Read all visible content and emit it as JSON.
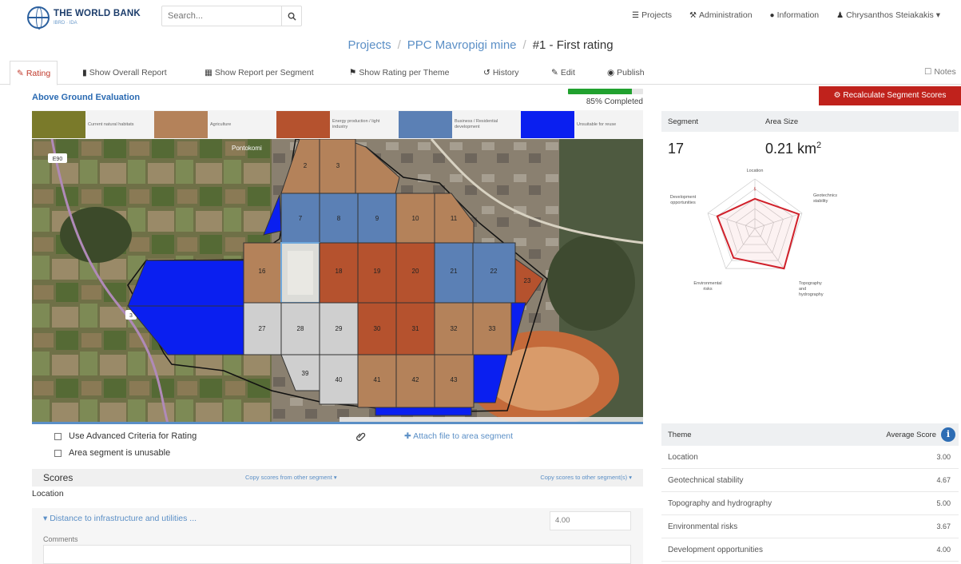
{
  "brand": {
    "name": "THE WORLD BANK",
    "sub": "IBRD · IDA"
  },
  "search": {
    "placeholder": "Search..."
  },
  "nav": {
    "projects": "Projects",
    "administration": "Administration",
    "information": "Information",
    "user": "Chrysanthos Steiakakis ▾"
  },
  "breadcrumb": {
    "projects": "Projects",
    "mine": "PPC Mavropigi mine",
    "current": "#1 - First rating"
  },
  "tabs": {
    "rating": "Rating",
    "overall_report": "Show Overall Report",
    "report_per_segment": "Show Report per Segment",
    "rating_per_theme": "Show Rating per Theme",
    "history": "History",
    "edit": "Edit",
    "publish": "Publish",
    "notes": "Notes"
  },
  "evaluation": {
    "title": "Above Ground Evaluation",
    "progress_percent": 85,
    "progress_label": "85% Completed"
  },
  "legend": [
    {
      "label": "Current natural habitats",
      "color": "#7a7a2a"
    },
    {
      "label": "Agriculture",
      "color": "#b4825a"
    },
    {
      "label": "Energy production / light industry",
      "color": "#b5522e"
    },
    {
      "label": "Business / Residential development",
      "color": "#5b80b5"
    },
    {
      "label": "Unsuitable for reuse",
      "color": "#0a1ff0"
    }
  ],
  "map": {
    "labels": {
      "s2": "2",
      "s3": "3",
      "s7": "7",
      "s8": "8",
      "s9": "9",
      "s10": "10",
      "s11": "11",
      "s16": "16",
      "s18": "18",
      "s19": "19",
      "s20": "20",
      "s21": "21",
      "s22": "22",
      "s23": "23",
      "s27": "27",
      "s28": "28",
      "s29": "29",
      "s30": "30",
      "s31": "31",
      "s32": "32",
      "s33": "33",
      "s39": "39",
      "s40": "40",
      "s41": "41",
      "s42": "42",
      "s43": "43",
      "road": "E90",
      "village": "Pontokomi",
      "road2": "3"
    }
  },
  "options": {
    "advanced_criteria": "Use Advanced Criteria for Rating",
    "unusable": "Area segment is unusable",
    "attach": "Attach file to area segment"
  },
  "scores": {
    "title": "Scores",
    "copy_from": "Copy scores from other segment ▾",
    "copy_to": "Copy scores to other segment(s) ▾",
    "location_label": "Location",
    "criterion": "Distance to infrastructure and utilities ...",
    "criterion_value": "4.00",
    "comments_label": "Comments"
  },
  "segment": {
    "header_segment": "Segment",
    "header_area": "Area Size",
    "number": "17",
    "area": "0.21 km",
    "area_unit_sup": "2",
    "recalc_label": "Recalculate Segment Scores"
  },
  "radar": {
    "axes": [
      "Location",
      "Geotechnical stability",
      "Topography and hydrography",
      "Environmental risks",
      "Development opportunities"
    ],
    "values": [
      3.0,
      4.67,
      5.0,
      3.67,
      4.0
    ],
    "max": 5
  },
  "themes": {
    "header_theme": "Theme",
    "header_score": "Average Score",
    "rows": [
      {
        "name": "Location",
        "score": "3.00"
      },
      {
        "name": "Geotechnical stability",
        "score": "4.67"
      },
      {
        "name": "Topography and hydrography",
        "score": "5.00"
      },
      {
        "name": "Environmental risks",
        "score": "3.67"
      },
      {
        "name": "Development opportunities",
        "score": "4.00"
      }
    ]
  }
}
